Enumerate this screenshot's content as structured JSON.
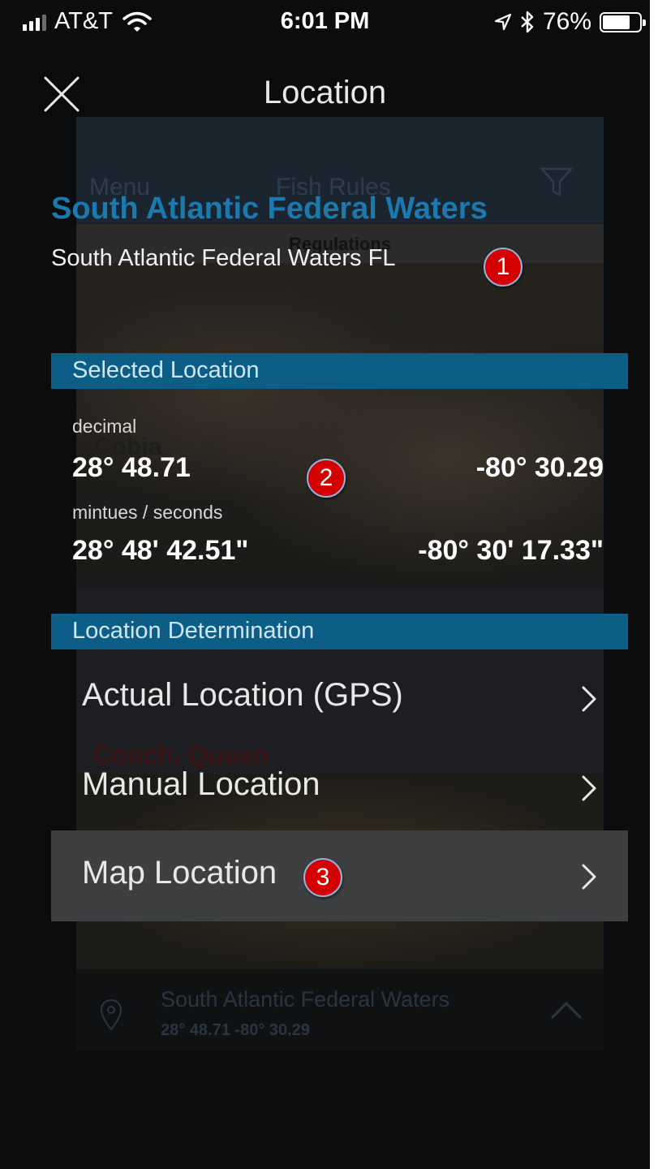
{
  "status_bar": {
    "carrier": "AT&T",
    "time": "6:01 PM",
    "battery_text": "76%",
    "battery_level": 0.76,
    "icons": [
      "signal-icon",
      "wifi-icon",
      "location-arrow-icon",
      "bluetooth-icon",
      "battery-icon"
    ]
  },
  "header": {
    "title": "Location",
    "close_icon": "close-icon"
  },
  "background_app": {
    "menu": "Menu",
    "app_name": "Fish Rules",
    "regulations": "Regulations",
    "species_1": "Cobia",
    "species_2": "Conch, Queen",
    "footer_title": "South Atlantic Federal Waters",
    "footer_coords": "28° 48.71  -80° 30.29"
  },
  "region": {
    "title": "South Atlantic Federal Waters",
    "subtitle": "South Atlantic Federal Waters FL"
  },
  "selected_location": {
    "header": "Selected Location",
    "decimal_label": "decimal",
    "decimal_lat": "28° 48.71",
    "decimal_lon": "-80° 30.29",
    "minsec_label": "mintues / seconds",
    "minsec_lat": "28° 48' 42.51\"",
    "minsec_lon": "-80° 30' 17.33\""
  },
  "determination": {
    "header": "Location Determination",
    "items": [
      {
        "label": "Actual Location (GPS)",
        "icon": "chevron-right-icon"
      },
      {
        "label": "Manual Location",
        "icon": "chevron-right-icon"
      },
      {
        "label": "Map Location",
        "icon": "chevron-right-icon",
        "highlighted": true
      }
    ]
  },
  "annotations": {
    "badge_1": "1",
    "badge_2": "2",
    "badge_3": "3"
  },
  "colors": {
    "accent_title": "#1b79ad",
    "section_bar": "#0d5e86",
    "highlight_row": "#3e3f41",
    "badge": "#d40000"
  }
}
